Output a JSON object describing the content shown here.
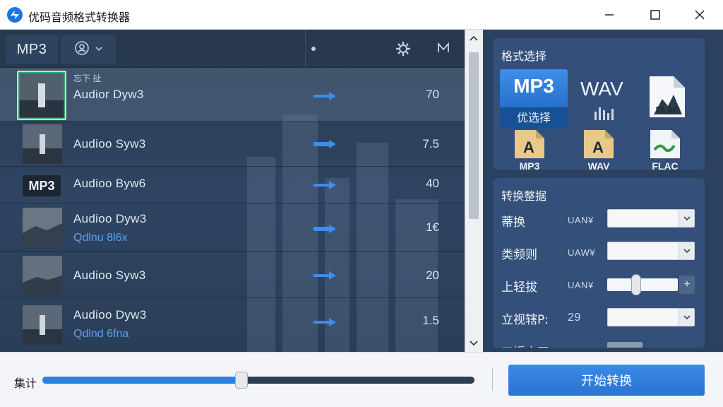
{
  "window": {
    "title": "优码音频格式转换器",
    "icon": "app-logo-icon",
    "controls": [
      "minimize",
      "maximize",
      "close"
    ]
  },
  "list_header": {
    "format_label": "MP3",
    "user_icon": "user-circle-icon",
    "settings_icon": "gear-icon",
    "m_icon": "m-icon"
  },
  "rows": [
    {
      "tag": "忘下 扯",
      "name": "Audior Dyw3",
      "sub": "",
      "value": "70",
      "selected": true,
      "thumb": "image"
    },
    {
      "tag": "",
      "name": "Audioo Syw3",
      "sub": "",
      "value": "7.5",
      "selected": false,
      "thumb": "image"
    },
    {
      "tag": "",
      "name": "Audioo Byw6",
      "sub": "",
      "value": "40",
      "selected": false,
      "thumb": "mp3",
      "thumb_label": "MP3"
    },
    {
      "tag": "",
      "name": "Audioo Dyw3",
      "sub": "Qdlnu 8l6x",
      "value": "1€",
      "selected": false,
      "thumb": "image"
    },
    {
      "tag": "",
      "name": "Audioo Syw3",
      "sub": "",
      "value": "20",
      "selected": false,
      "thumb": "image"
    },
    {
      "tag": "",
      "name": "Audioo Dyw3",
      "sub": "Qdlnd 6fna",
      "value": "1.5",
      "selected": false,
      "thumb": "image"
    }
  ],
  "format_panel": {
    "title": "格式选择",
    "selected_format": "MP3",
    "selected_sub": "优选择",
    "wav_label": "WAV",
    "flac_doc_text": "FLAC",
    "small_files": [
      {
        "label": "MP3",
        "letter": "A"
      },
      {
        "label": "WAV",
        "letter": "A"
      },
      {
        "label": "FLAC",
        "letter": "~"
      }
    ]
  },
  "settings_panel": {
    "title": "转换整据",
    "settings": [
      {
        "label": "蒂换",
        "unit": "UAN¥",
        "type": "select"
      },
      {
        "label": "类频则",
        "unit": "UAW¥",
        "type": "select"
      },
      {
        "label": "上轻拔",
        "unit": "UAN¥",
        "type": "slider",
        "plus": "+"
      },
      {
        "label": "立视辖P:",
        "unit": "29",
        "type": "select"
      }
    ],
    "partial_label": "工垢本四"
  },
  "bottom": {
    "volume_label": "集计",
    "volume_value": 0.46,
    "start_button": "开始转换"
  },
  "colors": {
    "accent": "#2f80e0",
    "left_bg": "#2c405a",
    "right_bg": "#2c4160",
    "panel_bg": "#34507a",
    "link": "#5aa0f0"
  }
}
